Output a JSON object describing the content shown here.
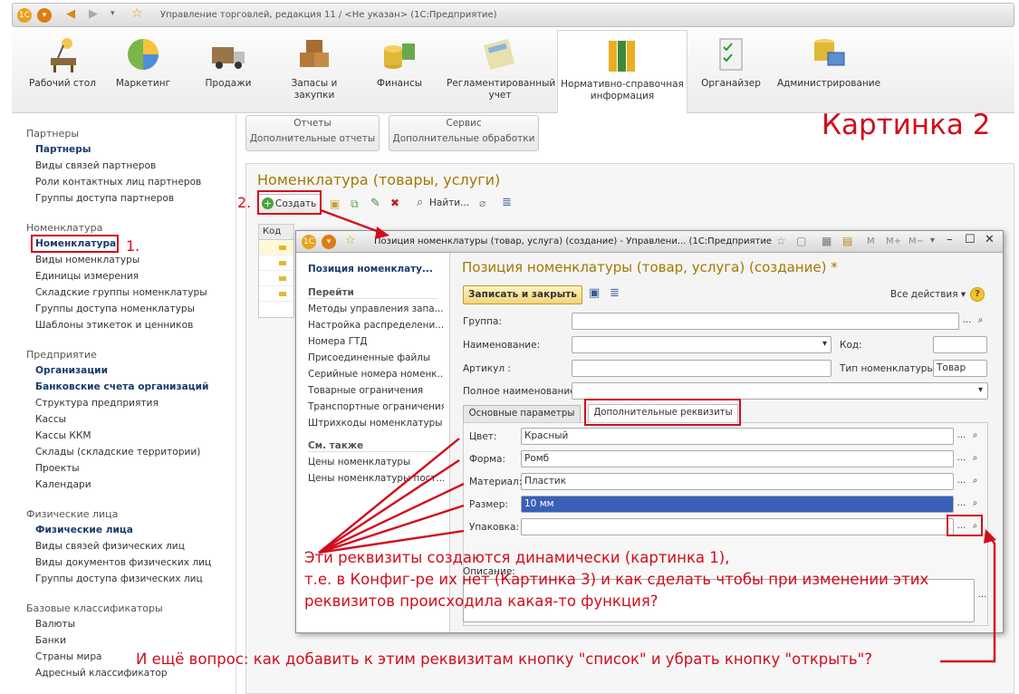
{
  "window": {
    "title": "Управление торговлей, редакция 11 / <Не указан> (1С:Предприятие)"
  },
  "sections": [
    {
      "label": "Рабочий стол"
    },
    {
      "label": "Маркетинг"
    },
    {
      "label": "Продажи"
    },
    {
      "label": "Запасы и закупки"
    },
    {
      "label": "Финансы"
    },
    {
      "label": "Регламентированный учет"
    },
    {
      "label": "Нормативно-справочная информация"
    },
    {
      "label": "Органайзер"
    },
    {
      "label": "Администрирование"
    }
  ],
  "leftnav": {
    "g1": "Партнеры",
    "g1_items": [
      "Партнеры",
      "Виды связей партнеров",
      "Роли контактных лиц партнеров",
      "Группы доступа партнеров"
    ],
    "g2": "Номенклатура",
    "g2_items": [
      "Номенклатура",
      "Виды номенклатуры",
      "Единицы измерения",
      "Складские группы номенклатуры",
      "Группы доступа номенклатуры",
      "Шаблоны этикеток и ценников"
    ],
    "g3": "Предприятие",
    "g3_items": [
      "Организации",
      "Банковские счета организаций",
      "Структура предприятия",
      "Кассы",
      "Кассы ККМ",
      "Склады (складские территории)",
      "Проекты",
      "Календари"
    ],
    "g4": "Физические лица",
    "g4_items": [
      "Физические лица",
      "Виды связей физических лиц",
      "Виды документов физических лиц",
      "Группы доступа физических лиц"
    ],
    "g5": "Базовые классификаторы",
    "g5_items": [
      "Валюты",
      "Банки",
      "Страны мира",
      "Адресный классификатор"
    ]
  },
  "commands": {
    "reports": "Отчеты",
    "reports_sub": "Дополнительные отчеты",
    "service": "Сервис",
    "service_sub": "Дополнительные обработки"
  },
  "list": {
    "title": "Номенклатура (товары, услуги)",
    "create": "Создать",
    "find": "Найти...",
    "col_code": "Код"
  },
  "dialog": {
    "wtitle": "Позиция номенклатуры (товар, услуга) (создание) - Управлени... (1С:Предприятие)",
    "nav_title": "Позиция номенклату...",
    "goto": "Перейти",
    "goto_items": [
      "Методы управления запа...",
      "Настройка распределени...",
      "Номера ГТД",
      "Присоединенные файлы",
      "Серийные номера номенк...",
      "Товарные ограничения",
      "Транспортные ограничения",
      "Штрихкоды номенклатуры"
    ],
    "see_also": "См. также",
    "see_items": [
      "Цены номенклатуры",
      "Цены номенклатуры пост..."
    ],
    "heading": "Позиция номенклатуры (товар, услуга) (создание) *",
    "save_close": "Записать и закрыть",
    "all_actions": "Все действия ▾",
    "help": "?",
    "group_lbl": "Группа:",
    "name_lbl": "Наименование:",
    "code_lbl": "Код:",
    "article_lbl": "Артикул :",
    "type_lbl": "Тип номенклатуры:",
    "type_val": "Товар",
    "fullname_lbl": "Полное наименование:",
    "tab1": "Основные параметры",
    "tab2": "Дополнительные реквизиты",
    "attrs": [
      {
        "label": "Цвет:",
        "value": "Красный"
      },
      {
        "label": "Форма:",
        "value": "Ромб"
      },
      {
        "label": "Материал:",
        "value": "Пластик"
      },
      {
        "label": "Размер:",
        "value": "10 мм"
      },
      {
        "label": "Упаковка:",
        "value": ""
      }
    ],
    "desc_lbl": "Описание:"
  },
  "annotations": {
    "title": "Картинка 2",
    "n1": "1.",
    "n2": "2.",
    "q1_l1": "Эти реквизиты создаются динамически (картинка 1),",
    "q1_l2": "т.е. в Конфиг-ре их нет (Картинка 3) и как сделать чтобы при изменении этих",
    "q1_l3": "реквизитов происходила какая-то функция?",
    "q2": "И ещё вопрос: как добавить к этим реквизитам кнопку \"список\" и убрать кнопку \"открыть\"?"
  },
  "colors": {
    "accent_red": "#d10d1c",
    "gold": "#a07a00",
    "link_blue": "#1a3a6b",
    "selection": "#3a5fb8"
  }
}
